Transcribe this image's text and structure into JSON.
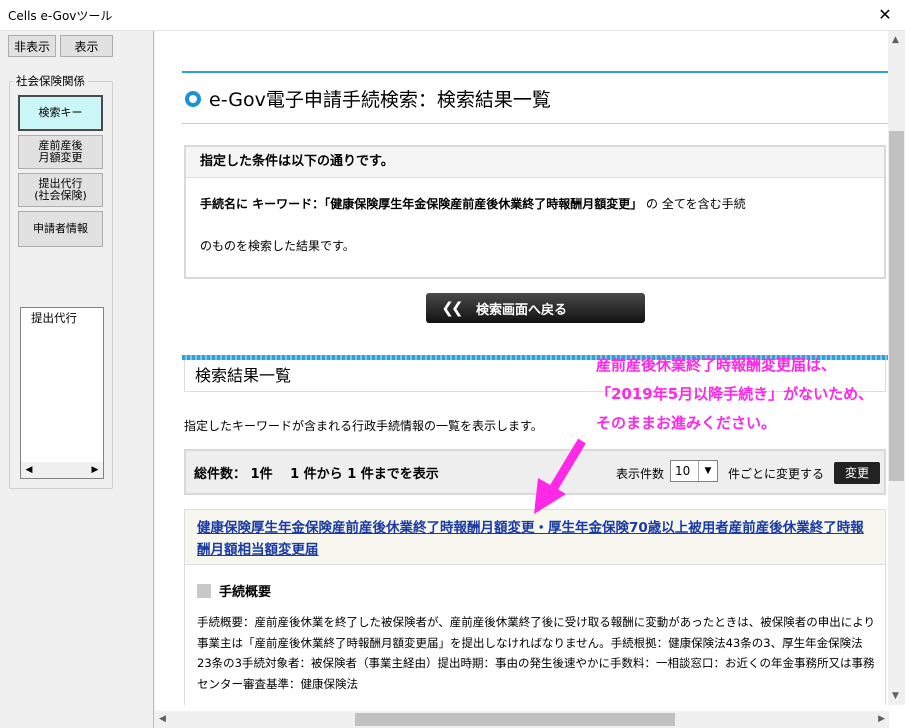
{
  "window": {
    "title": "Cells e-Govツール",
    "close": "✕"
  },
  "toolbar": {
    "hide_label": "非表示",
    "show_label": "表示"
  },
  "sidebar": {
    "group_title": "社会保険関係",
    "items": [
      {
        "label": "検索キー"
      },
      {
        "label": "産前産後\n月額変更"
      },
      {
        "label": "提出代行\n(社会保険)"
      },
      {
        "label": "申請者情報"
      }
    ],
    "list_item": "提出代行"
  },
  "page": {
    "heading": "e-Gov電子申請手続検索：検索結果一覧",
    "conditions_header": "指定した条件は以下の通りです。",
    "conditions_line1_prefix": "手続名に キーワード：",
    "conditions_keyword": "「健康保険厚生年金保険産前産後休業終了時報酬月額変更」",
    "conditions_line1_suffix": " の 全てを含む手続",
    "conditions_line2": "のものを検索した結果です。",
    "back_button": "検索画面へ戻る",
    "section_title": "検索結果一覧",
    "section_desc": "指定したキーワードが含まれる行政手続情報の一覧を表示します。",
    "total": "総件数： 1件　 1 件から 1 件までを表示",
    "per_page_label": "表示件数",
    "per_page_value": "10",
    "per_page_suffix": "件ごとに変更する",
    "change_button": "変更",
    "result_title": "健康保険厚生年金保険産前産後休業終了時報酬月額変更・厚生年金保険70歳以上被用者産前産後休業終了時報酬月額相当額変更届",
    "summary_heading": "手続概要",
    "summary_body": "手続概要：産前産後休業を終了した被保険者が、産前産後休業終了後に受け取る報酬に変動があったときは、被保険者の申出により事業主は「産前産後休業終了時報酬月額変更届」を提出しなければなりません。手続根拠：健康保険法43条の3、厚生年金保険法23条の3手続対象者：被保険者（事業主経由）提出時期：事由の発生後速やかに手数料：一相談窓口：お近くの年金事務所又は事務センター審査基準：健康保険法"
  },
  "annotation": {
    "line1": "産前産後休業終了時報酬変更届は、",
    "line2": "「2019年5月以降手続き」がないため、",
    "line3": "そのままお進みください。"
  },
  "colors": {
    "accent": "#2ba3d9",
    "annotation": "#ff28e6",
    "link": "#1a3aa6",
    "active_button": "#ccf7f9"
  }
}
